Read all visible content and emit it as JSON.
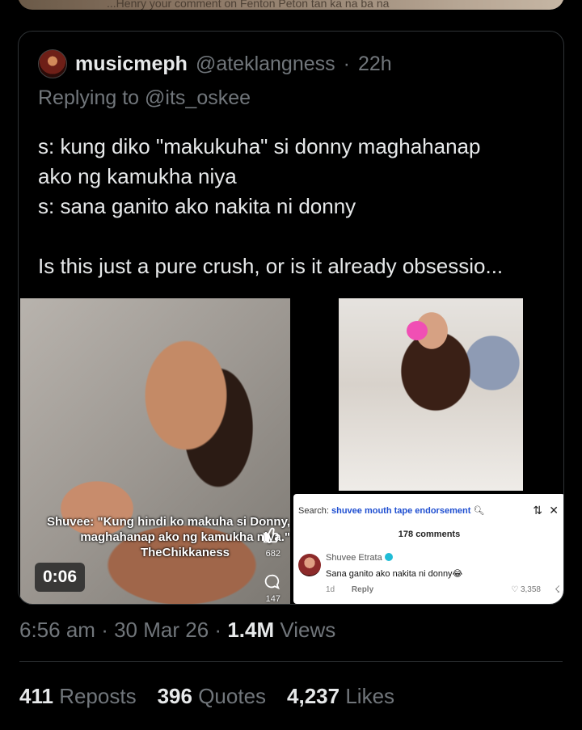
{
  "top_strip": {
    "text": "...Henry your comment on Fenton Peton tan ka na ba na"
  },
  "quoted_tweet": {
    "display_name": "musicmeph",
    "handle": "@ateklangness",
    "separator": "·",
    "time": "22h",
    "replying_prefix": "Replying to",
    "replying_to": "@its_oskee",
    "body_lines": [
      "s: kung diko \"makukuha\" si donny maghahanap",
      "ako ng kamukha niya",
      "s: sana ganito ako nakita ni donny",
      "",
      "Is this just a pure crush, or is it already obsessio..."
    ],
    "video": {
      "caption_line1": "Shuvee: \"Kung hindi ko makuha si Donny,",
      "caption_line2": "maghahanap ako ng kamukha niya.\"",
      "caption_credit": "TheChikkaness",
      "like_count": "682",
      "comment_count": "147",
      "duration": "0:06"
    },
    "comment_screenshot": {
      "search_label": "Search:",
      "search_term": "shuvee mouth tape endorsement",
      "comments_count": "178 comments",
      "commenter": "Shuvee Etrata",
      "comment_text": "Sana ganito ako nakita ni donny😂",
      "age": "1d",
      "reply_label": "Reply",
      "likes": "3,358"
    }
  },
  "meta": {
    "time": "6:56 am",
    "date": "30 Mar 26",
    "views_count": "1.4M",
    "views_label": "Views",
    "separator": "·"
  },
  "stats": {
    "reposts_count": "411",
    "reposts_label": "Reposts",
    "quotes_count": "396",
    "quotes_label": "Quotes",
    "likes_count": "4,237",
    "likes_label": "Likes"
  },
  "colors": {
    "background": "#000000",
    "text": "#e7e9ea",
    "muted": "#71767b",
    "border": "#2f3336"
  }
}
